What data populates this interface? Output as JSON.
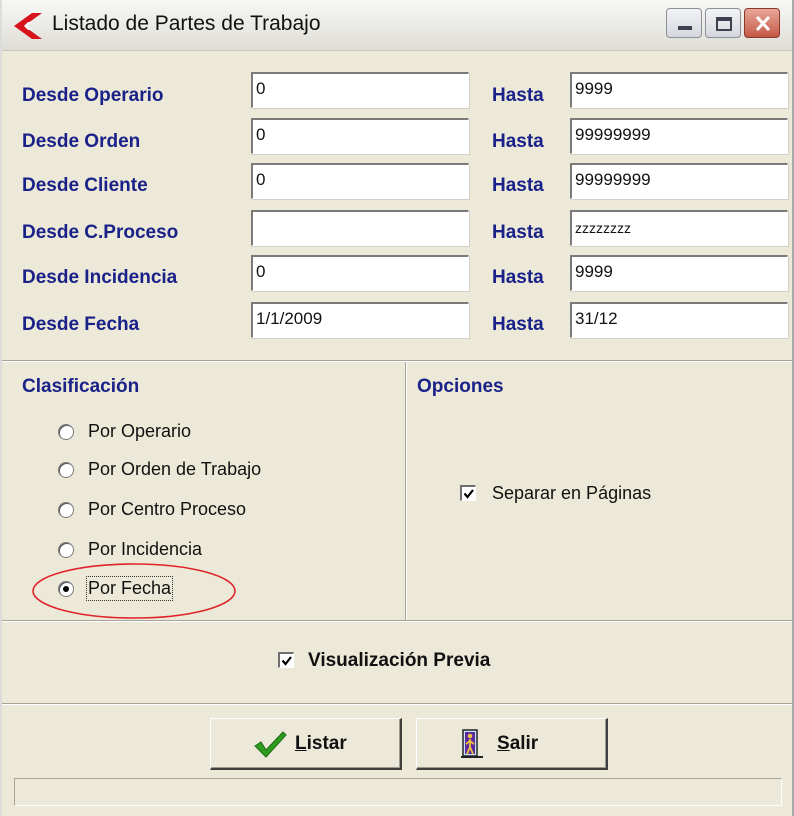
{
  "window": {
    "title": "Listado de Partes de Trabajo"
  },
  "ranges": [
    {
      "label": "Desde Operario",
      "from": "0",
      "to_label": "Hasta",
      "to": "9999"
    },
    {
      "label": "Desde Orden",
      "from": "0",
      "to_label": "Hasta",
      "to": "99999999"
    },
    {
      "label": "Desde Cliente",
      "from": "0",
      "to_label": "Hasta",
      "to": "99999999"
    },
    {
      "label": "Desde C.Proceso",
      "from": "",
      "to_label": "Hasta",
      "to": "zzzzzzzz"
    },
    {
      "label": "Desde Incidencia",
      "from": "0",
      "to_label": "Hasta",
      "to": "9999"
    },
    {
      "label": "Desde Fecha",
      "from": "1/1/2009",
      "to_label": "Hasta",
      "to": "31/12"
    }
  ],
  "clasificacion": {
    "title": "Clasificación",
    "options": [
      "Por Operario",
      "Por Orden de Trabajo",
      "Por Centro Proceso",
      "Por Incidencia",
      "Por Fecha"
    ],
    "selected": "Por Fecha"
  },
  "opciones": {
    "title": "Opciones",
    "separar_label": "Separar en Páginas",
    "separar_checked": true
  },
  "preview": {
    "label": "Visualización Previa",
    "checked": true
  },
  "buttons": {
    "listar_mnemonic": "L",
    "listar_rest": "istar",
    "salir_mnemonic": "S",
    "salir_rest": "alir"
  },
  "statusbar": {
    "text": ""
  },
  "icons": {
    "app": "red-chevron-icon",
    "listar": "green-check-icon",
    "salir": "exit-door-icon"
  },
  "colors": {
    "label_blue": "#1a2188",
    "annotation_red": "#e0242a"
  }
}
